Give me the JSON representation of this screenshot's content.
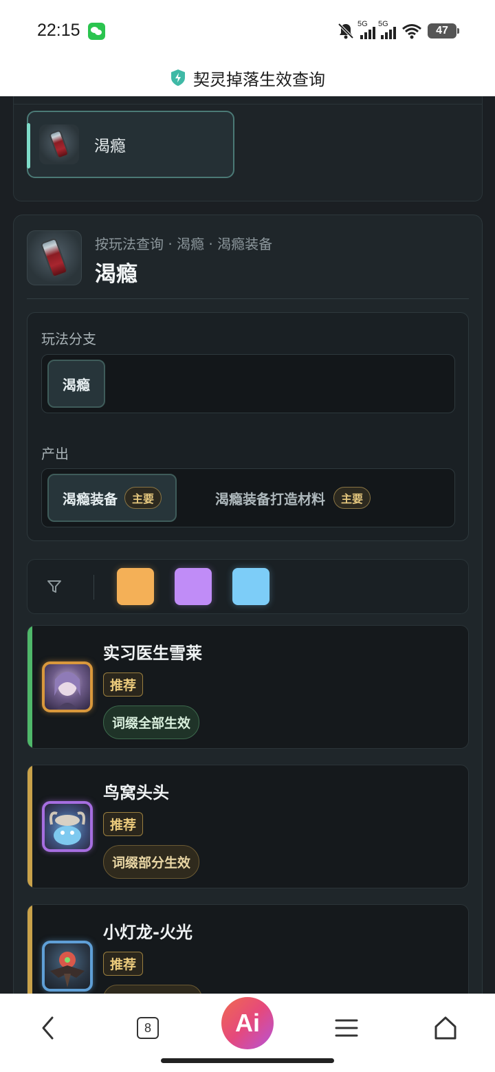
{
  "status_bar": {
    "time": "22:15",
    "battery": "47",
    "signal_1": "5G",
    "signal_2": "5G"
  },
  "app": {
    "title": "契灵掉落生效查询"
  },
  "selector": {
    "selected_label": "渴瘾"
  },
  "detail": {
    "breadcrumb": "按玩法查询 · 渴瘾 · 渴瘾装备",
    "title": "渴瘾",
    "branch_label": "玩法分支",
    "branch_options": [
      "渴瘾"
    ],
    "output_label": "产出",
    "outputs": [
      {
        "label": "渴瘾装备",
        "badge": "主要"
      },
      {
        "label": "渴瘾装备打造材料",
        "badge": "主要"
      }
    ]
  },
  "color_filter": {
    "icon": "funnel-icon",
    "swatches": [
      "#f4b057",
      "#c08cf7",
      "#7dcdf8"
    ]
  },
  "results": [
    {
      "name": "实习医生雪莱",
      "tag": "推荐",
      "effect": "词缀全部生效",
      "stripe": "#4fb86a",
      "frame": "#d9983c"
    },
    {
      "name": "鸟窝头头",
      "tag": "推荐",
      "effect": "词缀部分生效",
      "stripe": "#c9a24a",
      "frame": "#a66ee0"
    },
    {
      "name": "小灯龙-火光",
      "tag": "推荐",
      "effect": "",
      "stripe": "#c9a24a",
      "frame": "#5f9fd6"
    }
  ],
  "bottom_nav": {
    "tab_count": "8",
    "ai_label": "Ai"
  }
}
